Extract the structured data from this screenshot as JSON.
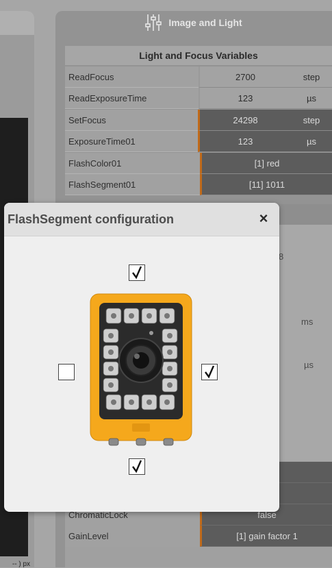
{
  "panel": {
    "title": "Image and Light",
    "table_title": "Light and Focus Variables",
    "rows": [
      {
        "label": "ReadFocus",
        "value": "2700",
        "unit": "step"
      },
      {
        "label": "ReadExposureTime",
        "value": "123",
        "unit": "µs"
      },
      {
        "label": "SetFocus",
        "value": "24298",
        "unit": "step"
      },
      {
        "label": "ExposureTime01",
        "value": "123",
        "unit": "µs"
      },
      {
        "label": "FlashColor01",
        "value": "[1] red"
      },
      {
        "label": "FlashSegment01",
        "value": "[11] 1011"
      }
    ],
    "background_fragments": {
      "digit": "8",
      "unit_ms": "ms",
      "unit_us": "µs"
    },
    "lower_rows": [
      {
        "label": "ChromaticLock",
        "value": "false"
      },
      {
        "label": "GainLevel",
        "value": "[1] gain factor 1"
      }
    ]
  },
  "left_panel": {
    "px_label": "-- ) px"
  },
  "dialog": {
    "title": "FlashSegment configuration",
    "close_glyph": "×",
    "segments": {
      "top": true,
      "left": false,
      "right": true,
      "bottom": true
    }
  },
  "colors": {
    "accent": "#c06a1a",
    "camera_body": "#f5a81c"
  }
}
